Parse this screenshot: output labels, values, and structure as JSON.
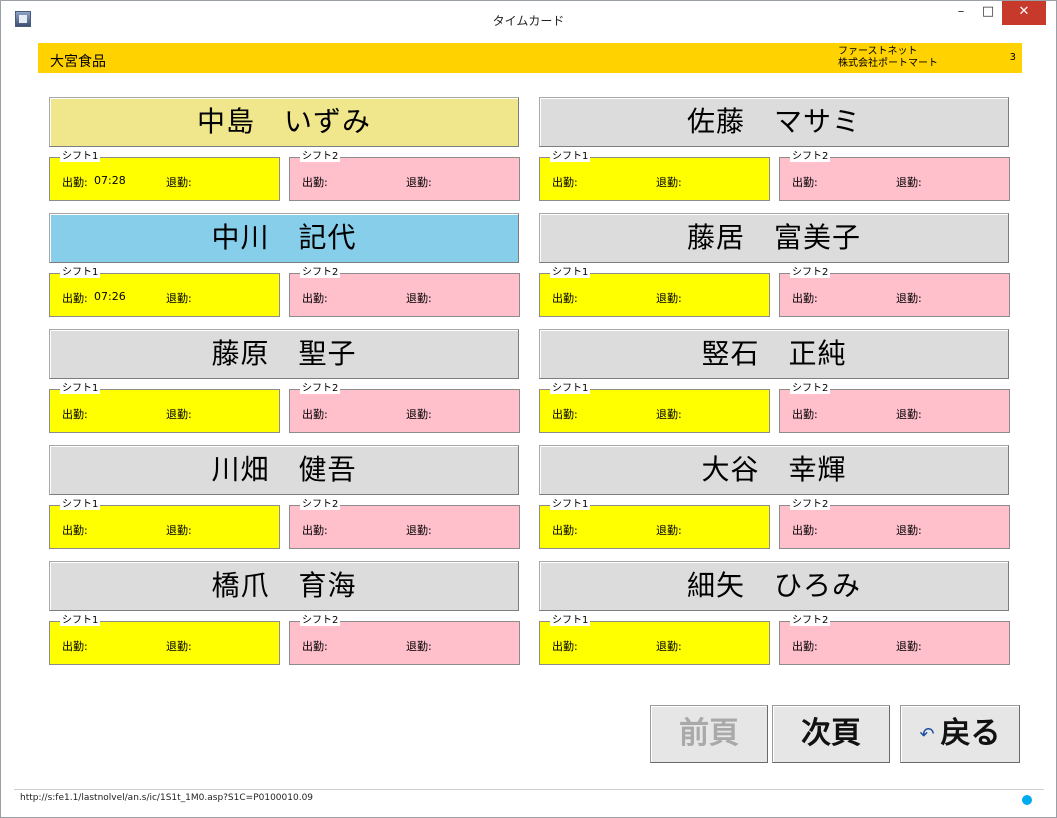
{
  "window": {
    "title": "タイムカード",
    "minimize": "–",
    "maximize": "□",
    "close": "✕"
  },
  "header": {
    "company": "大宮食品",
    "vendor_line1": "ファーストネット",
    "vendor_line2": "株式会社ポートマート",
    "page_number": "3"
  },
  "labels": {
    "shift1": "シフト1",
    "shift2": "シフト2",
    "clock_in": "出勤:",
    "clock_out": "退勤:"
  },
  "employees": [
    {
      "name": "中島　いずみ",
      "shift1_in": "07:28",
      "state": "sel1"
    },
    {
      "name": "佐藤　マサミ",
      "shift1_in": ""
    },
    {
      "name": "中川　記代",
      "shift1_in": "07:26",
      "state": "sel2"
    },
    {
      "name": "藤居　富美子",
      "shift1_in": ""
    },
    {
      "name": "藤原　聖子",
      "shift1_in": ""
    },
    {
      "name": "竪石　正純",
      "shift1_in": ""
    },
    {
      "name": "川畑　健吾",
      "shift1_in": ""
    },
    {
      "name": "大谷　幸輝",
      "shift1_in": ""
    },
    {
      "name": "橋爪　育海",
      "shift1_in": ""
    },
    {
      "name": "細矢　ひろみ",
      "shift1_in": ""
    }
  ],
  "nav": {
    "prev": "前頁",
    "next": "次頁",
    "back": "戻る",
    "back_icon": "↶"
  },
  "status": {
    "url": "http://s:fe1.1/lastnolvel/an.s/ic/1S1t_1M0.asp?S1C=P0100010.09"
  },
  "colors": {
    "header": "#ffd200",
    "shift1": "#ffff00",
    "shift2": "#ffc0cb",
    "selected_yellow": "#f0e68c",
    "selected_blue": "#87ceeb"
  }
}
